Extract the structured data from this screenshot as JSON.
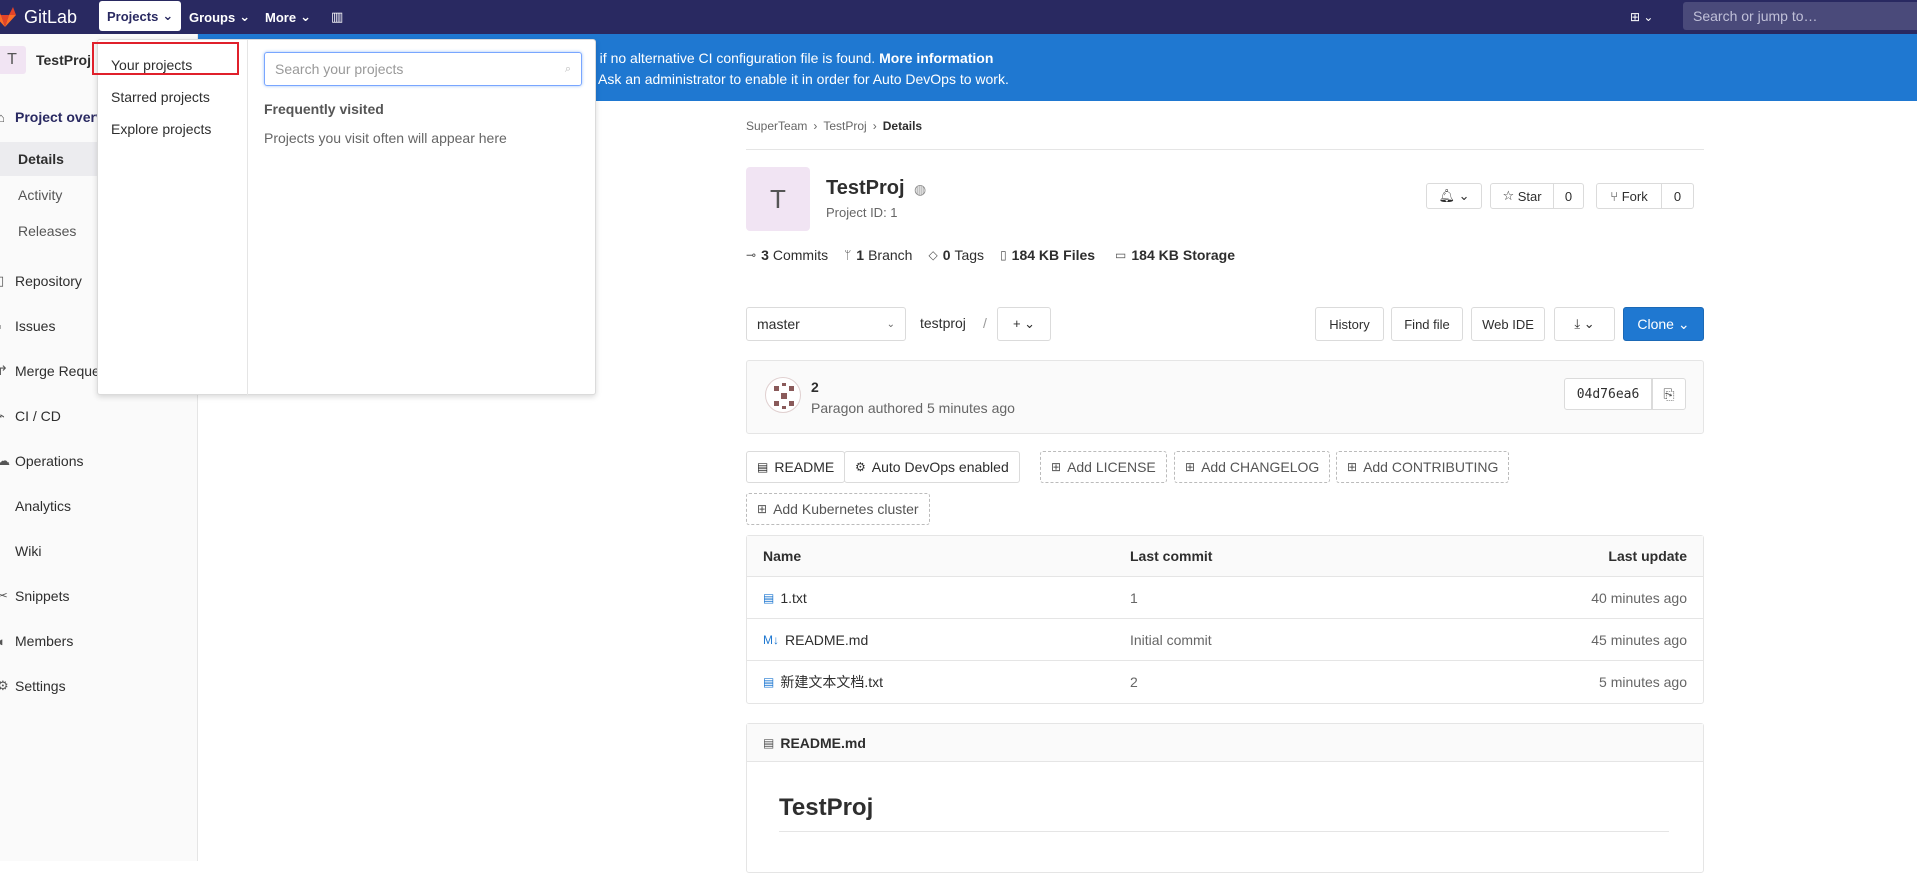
{
  "topbar": {
    "logo_text": "GitLab",
    "nav": [
      "Projects",
      "Groups",
      "More"
    ],
    "search_placeholder": "Search or jump to…"
  },
  "sidebar": {
    "avatar_letter": "T",
    "project_name": "TestProj",
    "overview": "Project overview",
    "sub_items": [
      "Details",
      "Activity",
      "Releases"
    ],
    "items": [
      "Repository",
      "Issues",
      "Merge Requests",
      "CI / CD",
      "Operations",
      "Analytics",
      "Wiki",
      "Snippets",
      "Members",
      "Settings"
    ]
  },
  "banner": {
    "line1_text": "d if no alternative CI configuration file is found.",
    "line1_link": "More information",
    "line2_text": "Ask an administrator to enable it in order for Auto DevOps to work."
  },
  "dropdown": {
    "links": [
      "Your projects",
      "Starred projects",
      "Explore projects"
    ],
    "search_placeholder": "Search your projects",
    "frequently_visited": "Frequently visited",
    "empty_text": "Projects you visit often will appear here"
  },
  "breadcrumbs": [
    "SuperTeam",
    "TestProj",
    "Details"
  ],
  "project": {
    "avatar_letter": "T",
    "title": "TestProj",
    "id_text": "Project ID: 1",
    "star_label": "Star",
    "star_count": "0",
    "fork_label": "Fork",
    "fork_count": "0"
  },
  "stats": [
    {
      "num": "3",
      "label": "Commits",
      "icon": "commit-icon"
    },
    {
      "num": "1",
      "label": "Branch",
      "icon": "branch-icon"
    },
    {
      "num": "0",
      "label": "Tags",
      "icon": "tag-icon"
    },
    {
      "num": "184 KB",
      "label": "Files",
      "icon": "file-icon"
    },
    {
      "num": "184 KB",
      "label": "Storage",
      "icon": "storage-icon"
    }
  ],
  "repo_toolbar": {
    "branch": "master",
    "path": "testproj",
    "buttons": [
      "History",
      "Find file",
      "Web IDE"
    ],
    "clone_label": "Clone"
  },
  "last_commit": {
    "title": "2",
    "author_line": "Paragon authored 5 minutes ago",
    "sha": "04d76ea6"
  },
  "quick_buttons": [
    "README",
    "Auto DevOps enabled",
    "Add LICENSE",
    "Add CHANGELOG",
    "Add CONTRIBUTING",
    "Add Kubernetes cluster"
  ],
  "file_table": {
    "headers": [
      "Name",
      "Last commit",
      "Last update"
    ],
    "rows": [
      {
        "name": "1.txt",
        "commit": "1",
        "updated": "40 minutes ago"
      },
      {
        "name": "README.md",
        "commit": "Initial commit",
        "updated": "45 minutes ago"
      },
      {
        "name": "新建文本文档.txt",
        "commit": "2",
        "updated": "5 minutes ago"
      }
    ]
  },
  "readme": {
    "filename": "README.md",
    "heading": "TestProj"
  },
  "colors": {
    "topbar": "#292961",
    "banner": "#1f78d1",
    "highlight": "#e0202b"
  }
}
